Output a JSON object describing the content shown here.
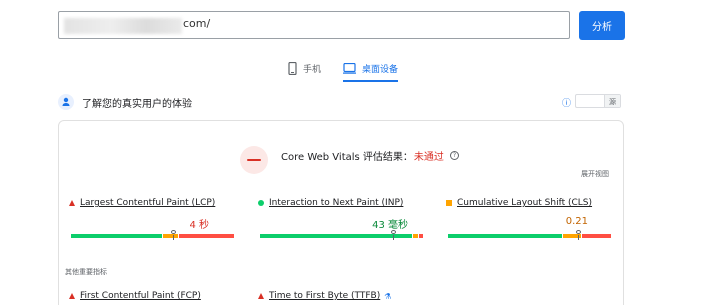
{
  "search": {
    "url_suffix": "com/",
    "analyze_label": "分析"
  },
  "device_tabs": [
    {
      "label": "手机",
      "icon": "phone-icon",
      "active": false
    },
    {
      "label": "桌面设备",
      "icon": "desktop-icon",
      "active": true
    }
  ],
  "section": {
    "title": "了解您的真实用户的体验",
    "toggle": {
      "option1": "",
      "option2": "源"
    }
  },
  "assessment": {
    "title": "Core Web Vitals 评估结果：",
    "status": "未通过",
    "expand_label": "展开视图"
  },
  "metrics": [
    {
      "label": "Largest Contentful Paint (LCP)",
      "value": "4 秒",
      "indicator": "fail",
      "value_color": "#d93025",
      "distribution": {
        "good": 0.56,
        "needs_improvement": 0.1,
        "poor": 0.34
      },
      "marker": 0.63
    },
    {
      "label": "Interaction to Next Paint (INP)",
      "value": "43 毫秒",
      "indicator": "pass",
      "value_color": "#0a8a3a",
      "distribution": {
        "good": 0.93,
        "needs_improvement": 0.04,
        "poor": 0.03
      },
      "marker": 0.82
    },
    {
      "label": "Cumulative Layout Shift (CLS)",
      "value": "0.21",
      "indicator": "average",
      "value_color": "#c26401",
      "distribution": {
        "good": 0.7,
        "needs_improvement": 0.12,
        "poor": 0.18
      },
      "marker": 0.8
    }
  ],
  "other_metrics_title": "其他重要指标",
  "other_metrics": [
    {
      "label": "First Contentful Paint (FCP)",
      "indicator": "fail"
    },
    {
      "label": "Time to First Byte (TTFB)",
      "indicator": "fail",
      "experimental": true
    }
  ],
  "colors": {
    "accent": "#1a73e8",
    "good": "#0cce6b",
    "average": "#ffa400",
    "poor": "#ff4e42",
    "fail_text": "#d93025"
  }
}
